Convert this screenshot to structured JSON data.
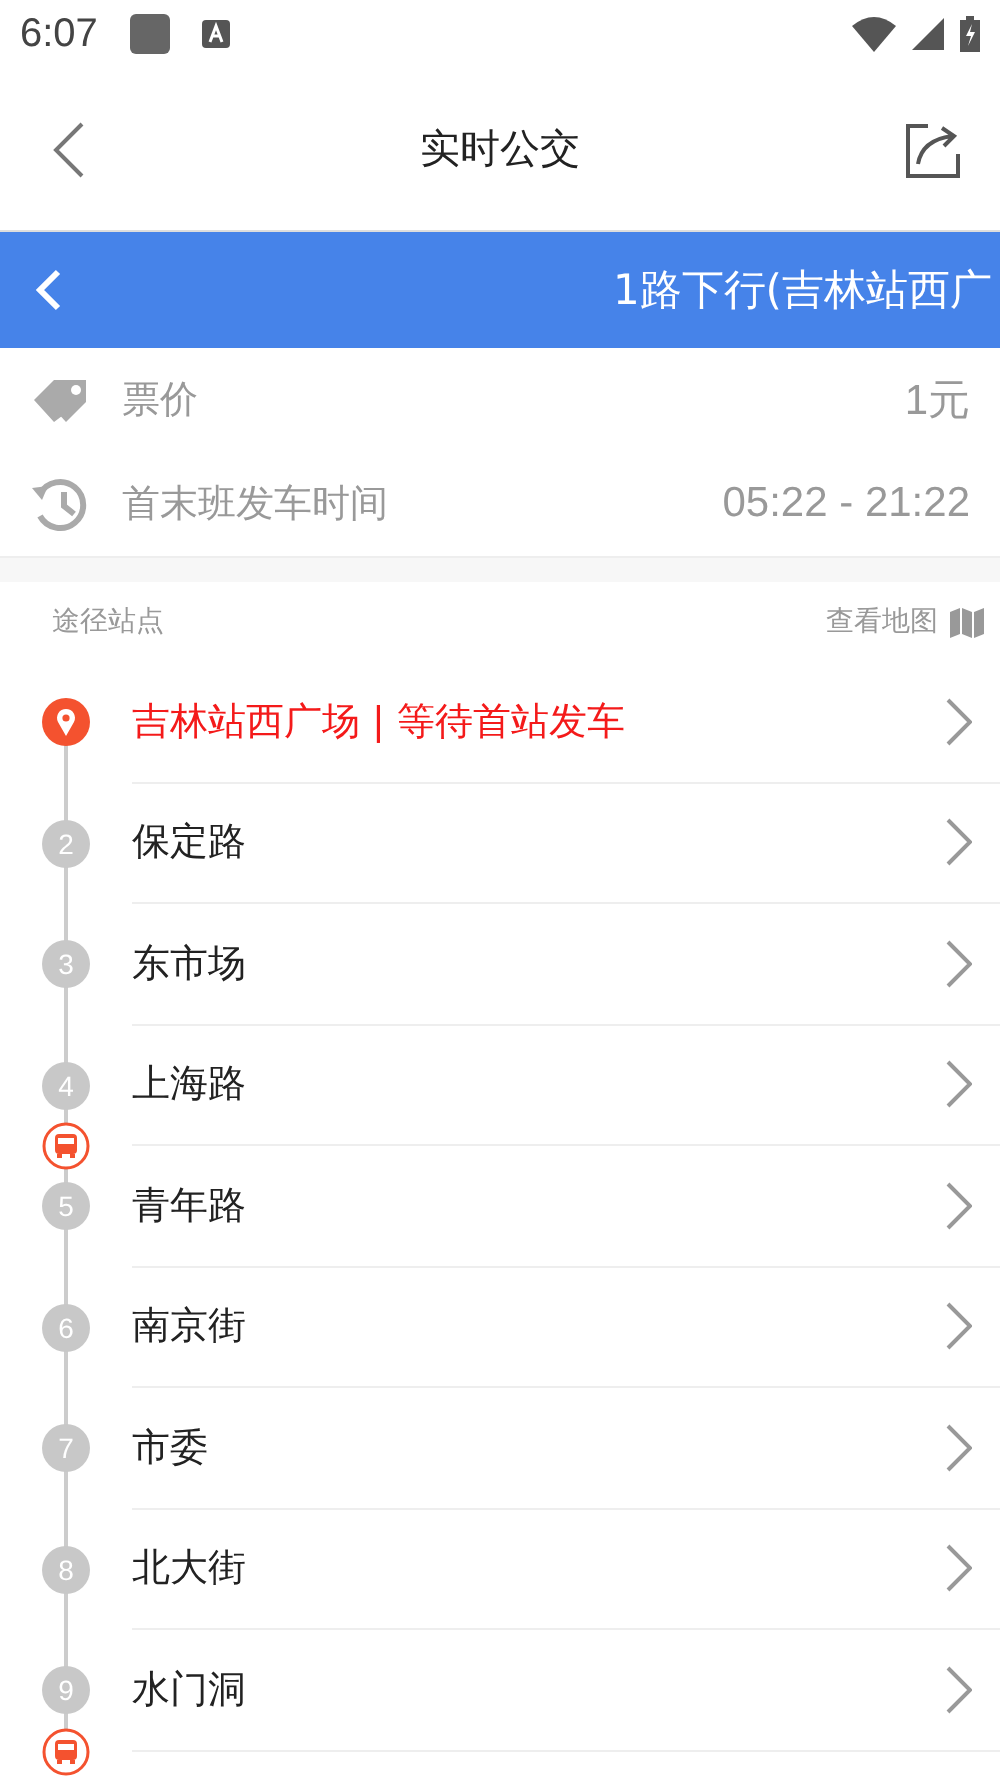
{
  "status_bar": {
    "time": "6:07"
  },
  "header": {
    "title": "实时公交"
  },
  "route_bar": {
    "title": "1路下行(吉林站西广"
  },
  "info": [
    {
      "kind": "price",
      "label": "票价",
      "value": "1元"
    },
    {
      "kind": "hours",
      "label": "首末班发车时间",
      "value": "05:22 - 21:22"
    }
  ],
  "stops_header": {
    "label": "途径站点",
    "map_link": "查看地图"
  },
  "stops": [
    {
      "kind": "origin",
      "name": "吉林站西广场 | 等待首站发车",
      "bus_after": false
    },
    {
      "kind": "stop",
      "number": "2",
      "name": "保定路",
      "bus_after": false
    },
    {
      "kind": "stop",
      "number": "3",
      "name": "东市场",
      "bus_after": false
    },
    {
      "kind": "stop",
      "number": "4",
      "name": "上海路",
      "bus_after": true
    },
    {
      "kind": "stop",
      "number": "5",
      "name": "青年路",
      "bus_after": false
    },
    {
      "kind": "stop",
      "number": "6",
      "name": "南京街",
      "bus_after": false
    },
    {
      "kind": "stop",
      "number": "7",
      "name": "市委",
      "bus_after": false
    },
    {
      "kind": "stop",
      "number": "8",
      "name": "北大街",
      "bus_after": false
    },
    {
      "kind": "stop",
      "number": "9",
      "name": "水门洞",
      "bus_after": true
    }
  ]
}
